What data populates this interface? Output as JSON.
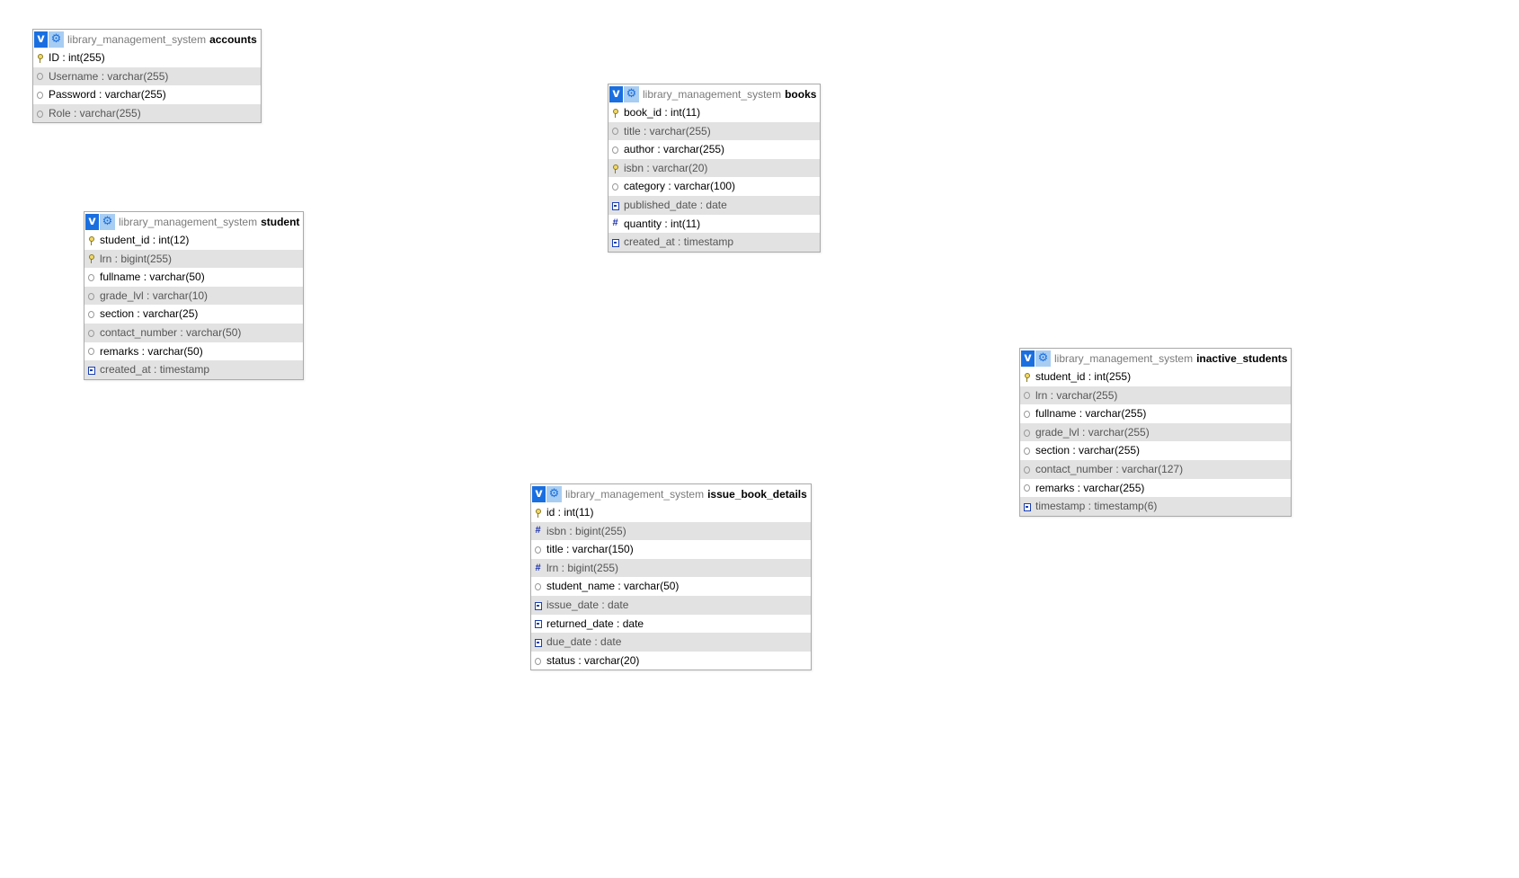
{
  "schema": "library_management_system",
  "tables": {
    "accounts": {
      "name": "accounts",
      "columns": [
        {
          "label": "ID : int(255)",
          "icon": "primary-key-icon"
        },
        {
          "label": "Username : varchar(255)",
          "icon": "text-field-icon"
        },
        {
          "label": "Password : varchar(255)",
          "icon": "text-field-icon"
        },
        {
          "label": "Role : varchar(255)",
          "icon": "text-field-icon"
        }
      ]
    },
    "books": {
      "name": "books",
      "columns": [
        {
          "label": "book_id : int(11)",
          "icon": "primary-key-icon"
        },
        {
          "label": "title : varchar(255)",
          "icon": "text-field-icon"
        },
        {
          "label": "author : varchar(255)",
          "icon": "text-field-icon"
        },
        {
          "label": "isbn : varchar(20)",
          "icon": "primary-key-icon"
        },
        {
          "label": "category : varchar(100)",
          "icon": "text-field-icon"
        },
        {
          "label": "published_date : date",
          "icon": "date-field-icon"
        },
        {
          "label": "quantity : int(11)",
          "icon": "numeric-field-icon"
        },
        {
          "label": "created_at : timestamp",
          "icon": "date-field-icon"
        }
      ]
    },
    "student": {
      "name": "student",
      "columns": [
        {
          "label": "student_id : int(12)",
          "icon": "primary-key-icon"
        },
        {
          "label": "lrn : bigint(255)",
          "icon": "primary-key-icon"
        },
        {
          "label": "fullname : varchar(50)",
          "icon": "text-field-icon"
        },
        {
          "label": "grade_lvl : varchar(10)",
          "icon": "text-field-icon"
        },
        {
          "label": "section : varchar(25)",
          "icon": "text-field-icon"
        },
        {
          "label": "contact_number : varchar(50)",
          "icon": "text-field-icon"
        },
        {
          "label": "remarks : varchar(50)",
          "icon": "text-field-icon"
        },
        {
          "label": "created_at : timestamp",
          "icon": "date-field-icon"
        }
      ]
    },
    "inactive_students": {
      "name": "inactive_students",
      "columns": [
        {
          "label": "student_id : int(255)",
          "icon": "primary-key-icon"
        },
        {
          "label": "lrn : varchar(255)",
          "icon": "text-field-icon"
        },
        {
          "label": "fullname : varchar(255)",
          "icon": "text-field-icon"
        },
        {
          "label": "grade_lvl : varchar(255)",
          "icon": "text-field-icon"
        },
        {
          "label": "section : varchar(255)",
          "icon": "text-field-icon"
        },
        {
          "label": "contact_number : varchar(127)",
          "icon": "text-field-icon"
        },
        {
          "label": "remarks : varchar(255)",
          "icon": "text-field-icon"
        },
        {
          "label": "timestamp : timestamp(6)",
          "icon": "date-field-icon"
        }
      ]
    },
    "issue_book_details": {
      "name": "issue_book_details",
      "columns": [
        {
          "label": "id : int(11)",
          "icon": "primary-key-icon"
        },
        {
          "label": "isbn : bigint(255)",
          "icon": "numeric-field-icon"
        },
        {
          "label": "title : varchar(150)",
          "icon": "text-field-icon"
        },
        {
          "label": "lrn : bigint(255)",
          "icon": "numeric-field-icon"
        },
        {
          "label": "student_name : varchar(50)",
          "icon": "text-field-icon"
        },
        {
          "label": "issue_date : date",
          "icon": "date-field-icon"
        },
        {
          "label": "returned_date : date",
          "icon": "date-field-icon"
        },
        {
          "label": "due_date : date",
          "icon": "date-field-icon"
        },
        {
          "label": "status : varchar(20)",
          "icon": "text-field-icon"
        }
      ]
    }
  },
  "ui": {
    "toggle_glyph": "v",
    "gear_glyph": "⚙",
    "numeric_glyph": "#"
  },
  "colors": {
    "header_button": "#1a6fe0",
    "gear_button": "#a8cdf2",
    "alt_row": "#e2e2e2",
    "border": "#aaaaaa"
  }
}
